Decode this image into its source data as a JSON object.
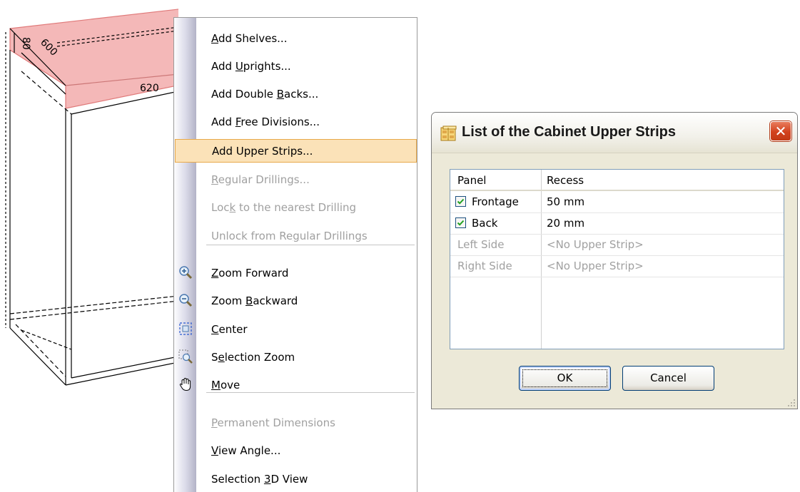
{
  "cabinet": {
    "dim_height": "80",
    "dim_depth": "600",
    "dim_width": "620"
  },
  "context_menu": {
    "items": [
      {
        "pre": "",
        "u": "A",
        "post": "dd Shelves...",
        "enabled": true
      },
      {
        "pre": "Add ",
        "u": "U",
        "post": "prights...",
        "enabled": true
      },
      {
        "pre": "Add Double ",
        "u": "B",
        "post": "acks...",
        "enabled": true
      },
      {
        "pre": "Add ",
        "u": "F",
        "post": "ree Divisions...",
        "enabled": true
      },
      {
        "pre": "Add Upper Strips...",
        "u": "",
        "post": "",
        "enabled": true,
        "highlighted": true
      },
      {
        "pre": "",
        "u": "R",
        "post": "egular Drillings...",
        "enabled": false
      },
      {
        "pre": "Loc",
        "u": "k",
        "post": " to the nearest Drilling",
        "enabled": false
      },
      {
        "pre": "Unlock from Re",
        "u": "g",
        "post": "ular Drillings",
        "enabled": false
      },
      {
        "pre": "",
        "u": "Z",
        "post": "oom Forward",
        "enabled": true,
        "icon": "zoom-in-icon"
      },
      {
        "pre": "Zoom ",
        "u": "B",
        "post": "ackward",
        "enabled": true,
        "icon": "zoom-out-icon"
      },
      {
        "pre": "",
        "u": "C",
        "post": "enter",
        "enabled": true,
        "icon": "center-icon"
      },
      {
        "pre": "S",
        "u": "e",
        "post": "lection Zoom",
        "enabled": true,
        "icon": "selection-zoom-icon"
      },
      {
        "pre": "",
        "u": "M",
        "post": "ove",
        "enabled": true,
        "icon": "hand-icon"
      },
      {
        "pre": "",
        "u": "P",
        "post": "ermanent Dimensions",
        "enabled": false
      },
      {
        "pre": "",
        "u": "V",
        "post": "iew Angle...",
        "enabled": true
      },
      {
        "pre": "Selection ",
        "u": "3",
        "post": "D View",
        "enabled": true
      }
    ]
  },
  "dialog": {
    "title": "List of the Cabinet Upper Strips",
    "close_glyph": "✕",
    "columns": [
      "Panel",
      "Recess"
    ],
    "rows": [
      {
        "panel": "Frontage",
        "recess": "50 mm",
        "checked": true,
        "enabled": true
      },
      {
        "panel": "Back",
        "recess": "20 mm",
        "checked": true,
        "enabled": true
      },
      {
        "panel": "Left Side",
        "recess": "<No Upper Strip>",
        "checked": false,
        "enabled": false
      },
      {
        "panel": "Right Side",
        "recess": "<No Upper Strip>",
        "checked": false,
        "enabled": false
      }
    ],
    "ok_label": "OK",
    "cancel_label": "Cancel"
  },
  "colors": {
    "highlight_bg": "#fbe2b8",
    "highlight_border": "#e8a94a",
    "top_panel_fill": "#f4b8b8",
    "close_red": "#d2411d"
  }
}
